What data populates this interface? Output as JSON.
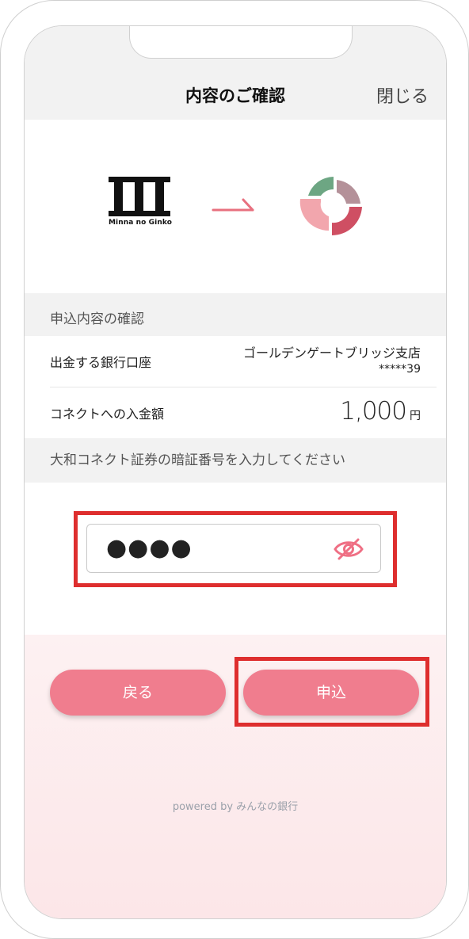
{
  "header": {
    "title": "内容のご確認",
    "close_label": "閉じる"
  },
  "logos": {
    "from_logo_text": "Minna no Ginko",
    "from_logo_name": "minna-no-ginko-logo",
    "to_logo_name": "daiwa-connect-logo"
  },
  "confirm_section": {
    "heading": "申込内容の確認",
    "withdraw_account": {
      "label": "出金する銀行口座",
      "branch": "ゴールデンゲートブリッジ支店",
      "account": "*****39"
    },
    "deposit": {
      "label": "コネクトへの入金額",
      "amount": "1,000",
      "unit": "円"
    }
  },
  "pin_section": {
    "heading": "大和コネクト証券の暗証番号を入力してください",
    "masked_value": "●●●●"
  },
  "buttons": {
    "back_label": "戻る",
    "submit_label": "申込"
  },
  "footer": {
    "powered": "powered by みんなの銀行"
  },
  "colors": {
    "accent": "#f07d8e",
    "highlight": "#de2e2e",
    "arrow": "#e8707f"
  }
}
